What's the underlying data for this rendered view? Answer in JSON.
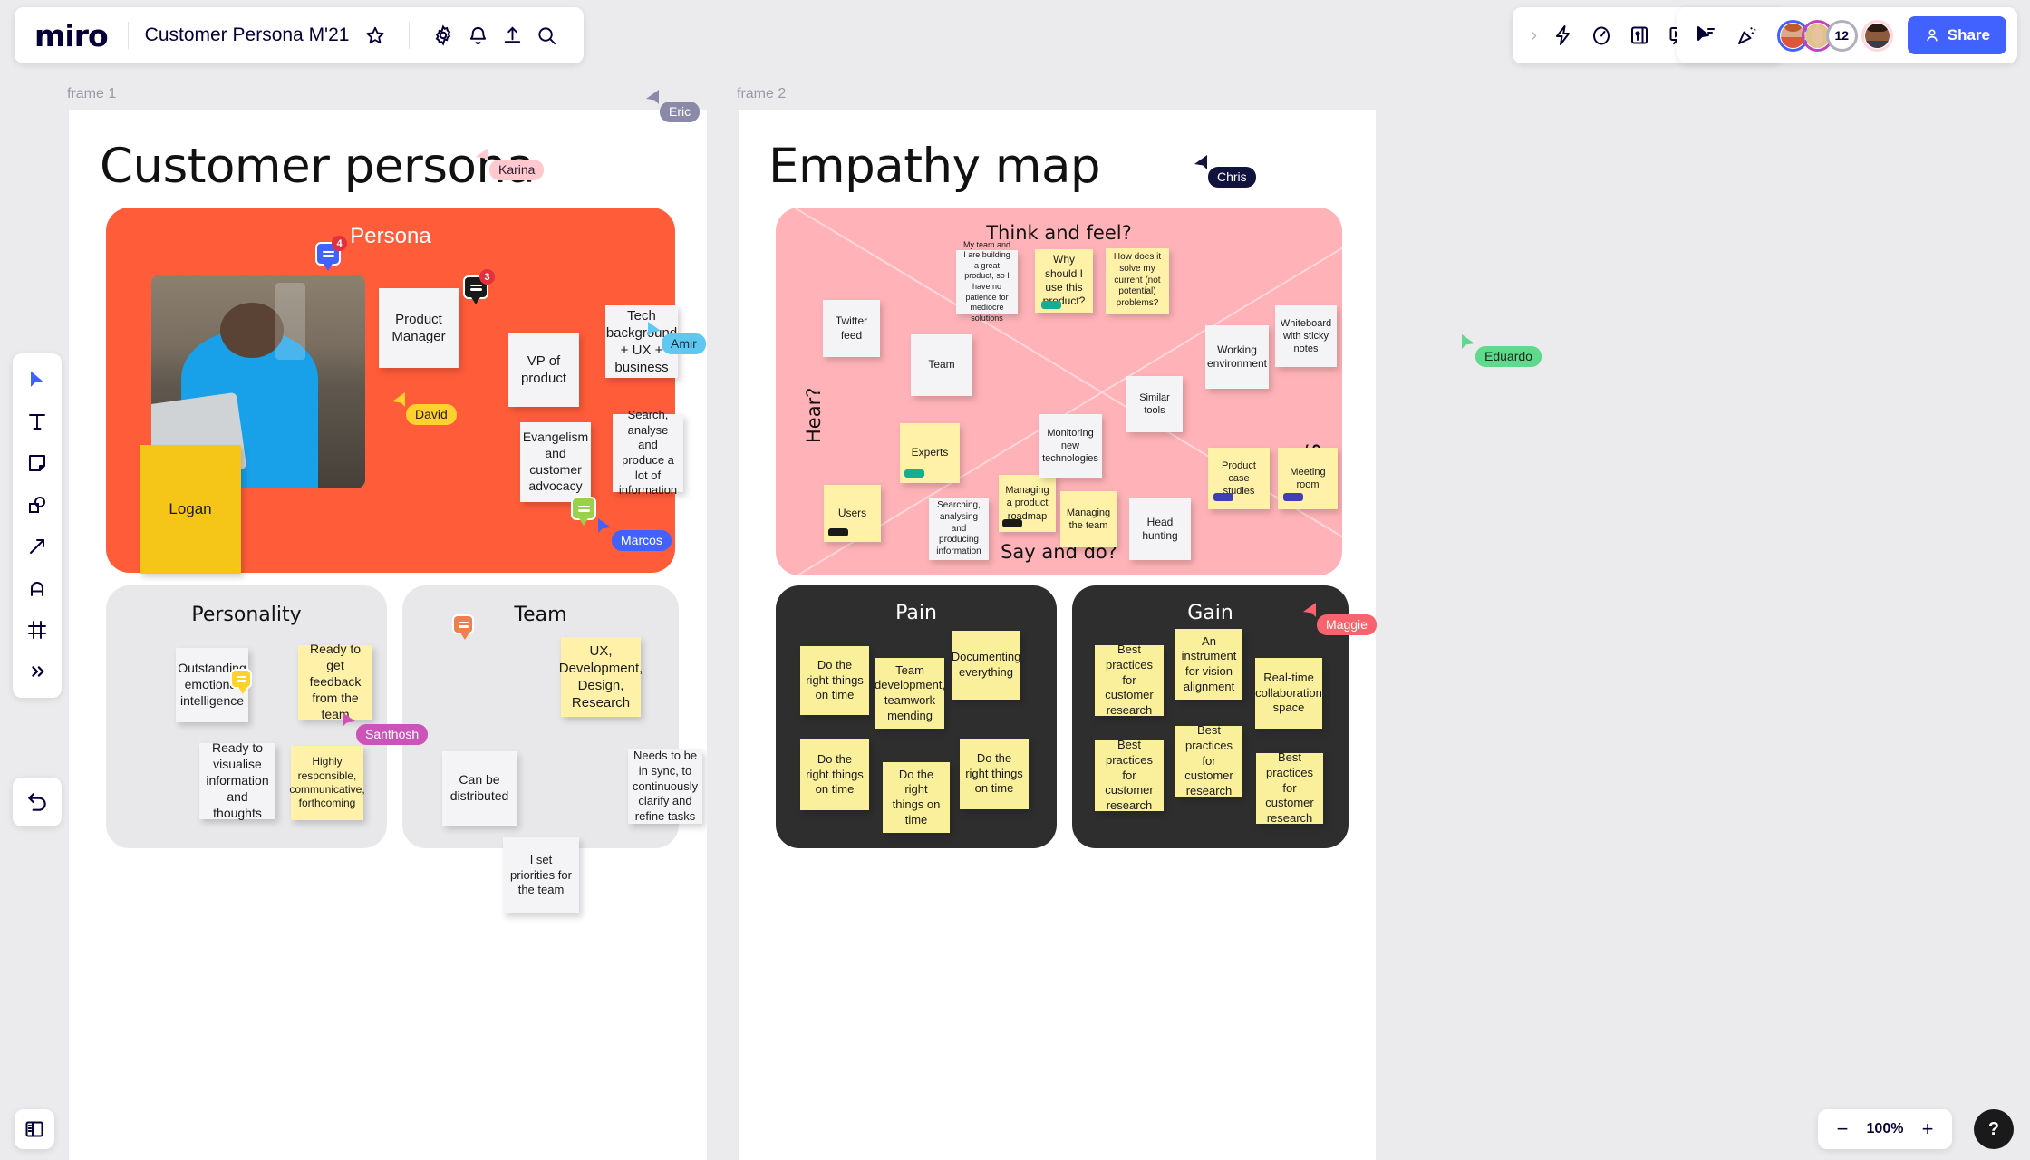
{
  "header": {
    "logo": "miro",
    "board_title": "Customer Persona M'21",
    "icons": {
      "star": "star-icon",
      "settings": "gear-icon",
      "notifications": "bell-icon",
      "upload": "upload-icon",
      "search": "search-icon",
      "expand": "chevron-right-icon",
      "bolt": "bolt-icon",
      "timer": "timer-icon",
      "card": "card-icon",
      "presentation": "presentation-icon",
      "document": "document-icon",
      "collapse": "chevron-double-down-icon",
      "select_cursor": "cursor-select-icon",
      "celebrate": "celebrate-icon"
    },
    "avatar_count_badge": "12",
    "share_label": "Share"
  },
  "left_toolbar": {
    "tools": [
      {
        "name": "select-tool",
        "icon": "cursor-icon"
      },
      {
        "name": "text-tool",
        "icon": "text-icon"
      },
      {
        "name": "sticky-note-tool",
        "icon": "sticky-note-icon"
      },
      {
        "name": "shapes-tool",
        "icon": "shapes-icon"
      },
      {
        "name": "connector-tool",
        "icon": "arrow-icon"
      },
      {
        "name": "pen-tool",
        "icon": "pen-icon"
      },
      {
        "name": "frame-tool",
        "icon": "frame-icon"
      },
      {
        "name": "more-tools",
        "icon": "chevron-double-right-icon"
      }
    ],
    "undo": "undo-icon",
    "panel_toggle": "panel-toggle-icon"
  },
  "zoom": {
    "minus": "−",
    "value": "100%",
    "plus": "+",
    "help": "?"
  },
  "frames": [
    {
      "label": "frame 1"
    },
    {
      "label": "frame 2"
    }
  ],
  "persona_frame": {
    "title": "Customer persona",
    "persona_label": "Persona",
    "photo_name": "Logan",
    "notes": [
      {
        "text": "Product Manager",
        "color": "white"
      },
      {
        "text": "VP of product",
        "color": "white"
      },
      {
        "text": "Tech background + UX + business",
        "color": "white"
      },
      {
        "text": "Evangelism and customer advocacy",
        "color": "white"
      },
      {
        "text": "Search, analyse and produce a lot of information",
        "color": "white"
      }
    ],
    "personality": {
      "title": "Personality",
      "notes": [
        {
          "text": "Outstanding emotional intelligence",
          "color": "white"
        },
        {
          "text": "Ready to get feedback from the team",
          "color": "yellow"
        },
        {
          "text": "Ready to visualise information and thoughts",
          "color": "white"
        },
        {
          "text": "Highly responsible, communicative, forthcoming",
          "color": "yellow"
        }
      ]
    },
    "team": {
      "title": "Team",
      "notes": [
        {
          "text": "Can be distributed",
          "color": "white"
        },
        {
          "text": "UX, Development, Design, Research",
          "color": "yellow"
        },
        {
          "text": "Needs to be in sync, to continuously clarify and refine tasks",
          "color": "white"
        },
        {
          "text": "I set priorities for the team",
          "color": "white"
        }
      ]
    }
  },
  "empathy_frame": {
    "title": "Empathy map",
    "quadrants": {
      "think_feel": "Think and feel?",
      "hear": "Hear?",
      "see": "See?",
      "say_do": "Say and do?"
    },
    "notes": [
      {
        "text": "My team and I are building a great product, so I have no patience for mediocre solutions",
        "color": "white"
      },
      {
        "text": "Why should I use this product?",
        "color": "yellow",
        "chip": "#17ad93"
      },
      {
        "text": "How does it solve my current (not potential) problems?",
        "color": "yellow"
      },
      {
        "text": "Twitter feed",
        "color": "white"
      },
      {
        "text": "Team",
        "color": "white"
      },
      {
        "text": "Users",
        "color": "yellow",
        "chip": "#1a1a1a"
      },
      {
        "text": "Experts",
        "color": "yellow",
        "chip": "#17ad93"
      },
      {
        "text": "Searching, analysing and producing information",
        "color": "white"
      },
      {
        "text": "Managing a product roadmap",
        "color": "yellow",
        "chip": "#1a1a1a"
      },
      {
        "text": "Monitoring new technologies",
        "color": "white"
      },
      {
        "text": "Managing the team",
        "color": "yellow"
      },
      {
        "text": "Head hunting",
        "color": "white"
      },
      {
        "text": "Similar tools",
        "color": "white"
      },
      {
        "text": "Working environment",
        "color": "white"
      },
      {
        "text": "Whiteboard with sticky notes",
        "color": "white"
      },
      {
        "text": "Product case studies",
        "color": "yellow",
        "chip": "#4040b2"
      },
      {
        "text": "Meeting room",
        "color": "yellow",
        "chip": "#4040b2"
      }
    ],
    "pain": {
      "title": "Pain",
      "notes": [
        {
          "text": "Do the right things on time"
        },
        {
          "text": "Team development, teamwork mending"
        },
        {
          "text": "Documenting everything"
        },
        {
          "text": "Do the right things on time"
        },
        {
          "text": "Do the right things on time"
        },
        {
          "text": "Do the right things on time"
        }
      ]
    },
    "gain": {
      "title": "Gain",
      "notes": [
        {
          "text": "Best practices for customer research"
        },
        {
          "text": "An instrument for vision alignment"
        },
        {
          "text": "Real-time collaboration space"
        },
        {
          "text": "Best practices for customer research"
        },
        {
          "text": "Best practices for customer research"
        },
        {
          "text": "Best practices for customer research"
        }
      ]
    }
  },
  "cursors": [
    {
      "name": "Eric",
      "color": "#8a8aa8",
      "text": "#ffffff"
    },
    {
      "name": "Karina",
      "color": "#ffc9ce",
      "text": "#2b1a33"
    },
    {
      "name": "Amir",
      "color": "#5ec8f0",
      "text": "#10303d"
    },
    {
      "name": "David",
      "color": "#ffd12e",
      "text": "#2b2200"
    },
    {
      "name": "Marcos",
      "color": "#4262ff",
      "text": "#ffffff"
    },
    {
      "name": "Santhosh",
      "color": "#cc54b8",
      "text": "#ffffff"
    },
    {
      "name": "Chris",
      "color": "#12123f",
      "text": "#ffffff"
    },
    {
      "name": "Eduardo",
      "color": "#5fd98b",
      "text": "#0d2b16"
    },
    {
      "name": "Maggie",
      "color": "#f9636e",
      "text": "#ffffff"
    }
  ],
  "comment_pins": [
    {
      "count": "4",
      "color": "#4262ff"
    },
    {
      "count": "3",
      "color": "#1a1a1a"
    },
    {
      "count": "",
      "color": "#9ad14b"
    },
    {
      "count": "",
      "color": "#ffd12e"
    },
    {
      "count": "",
      "color": "#ef7f4f"
    }
  ],
  "colors": {
    "brand": "#4262ff",
    "persona_bg": "#ff5c39",
    "empathy_bg": "#ffb3b8",
    "dark_bg": "#2e2e2e",
    "sticky_yellow": "#fff2a8",
    "sticky_white": "#f4f4f6"
  }
}
